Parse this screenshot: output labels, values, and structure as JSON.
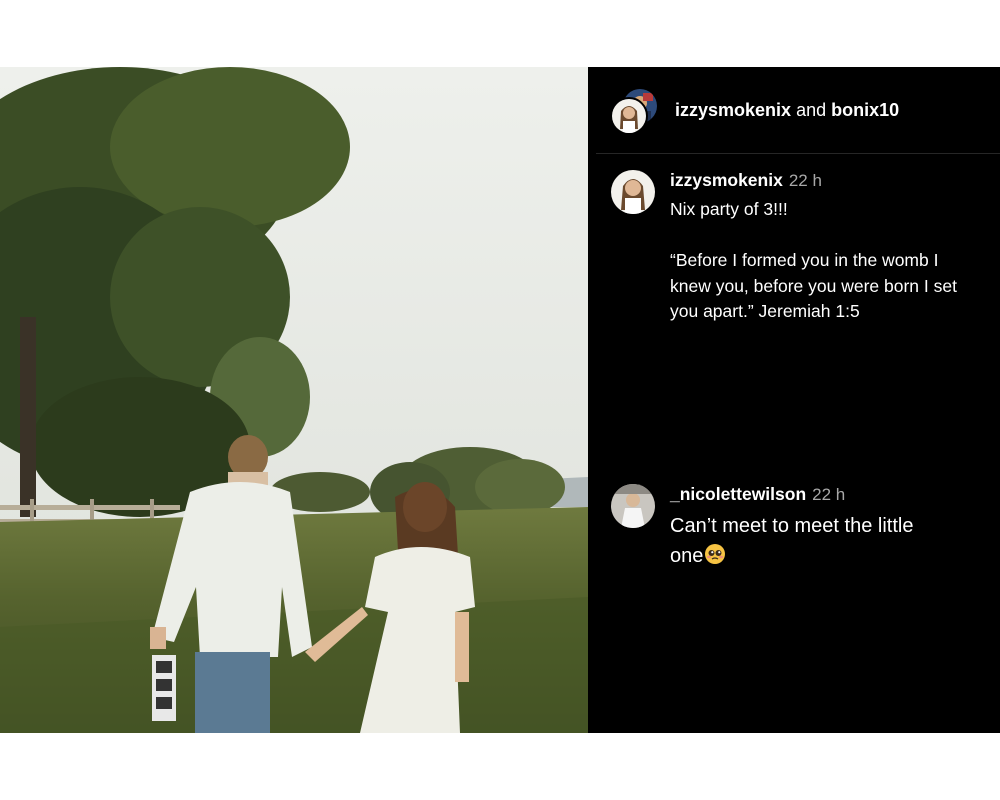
{
  "header": {
    "user1": "izzysmokenix",
    "connector": " and ",
    "user2": "bonix10"
  },
  "comments": [
    {
      "username": "izzysmokenix",
      "time": "22 h",
      "lines": [
        "Nix party of 3!!!",
        "",
        "“Before I formed you in the womb I",
        "knew you, before you were born I set",
        "you apart.” Jeremiah 1:5"
      ]
    },
    {
      "username": "_nicolettewilson",
      "time": "22 h",
      "lines": [
        "Can’t meet to meet the little",
        "one"
      ],
      "emoji": "pleading-face-emoji"
    }
  ],
  "colors": {
    "panel_background": "#000000",
    "text": "#ffffff",
    "timestamp": "#a8a8a8"
  },
  "icons": [
    "avatar-izzysmokenix",
    "avatar-bonix10",
    "avatar-nicolettewilson",
    "pleading-face-emoji"
  ]
}
